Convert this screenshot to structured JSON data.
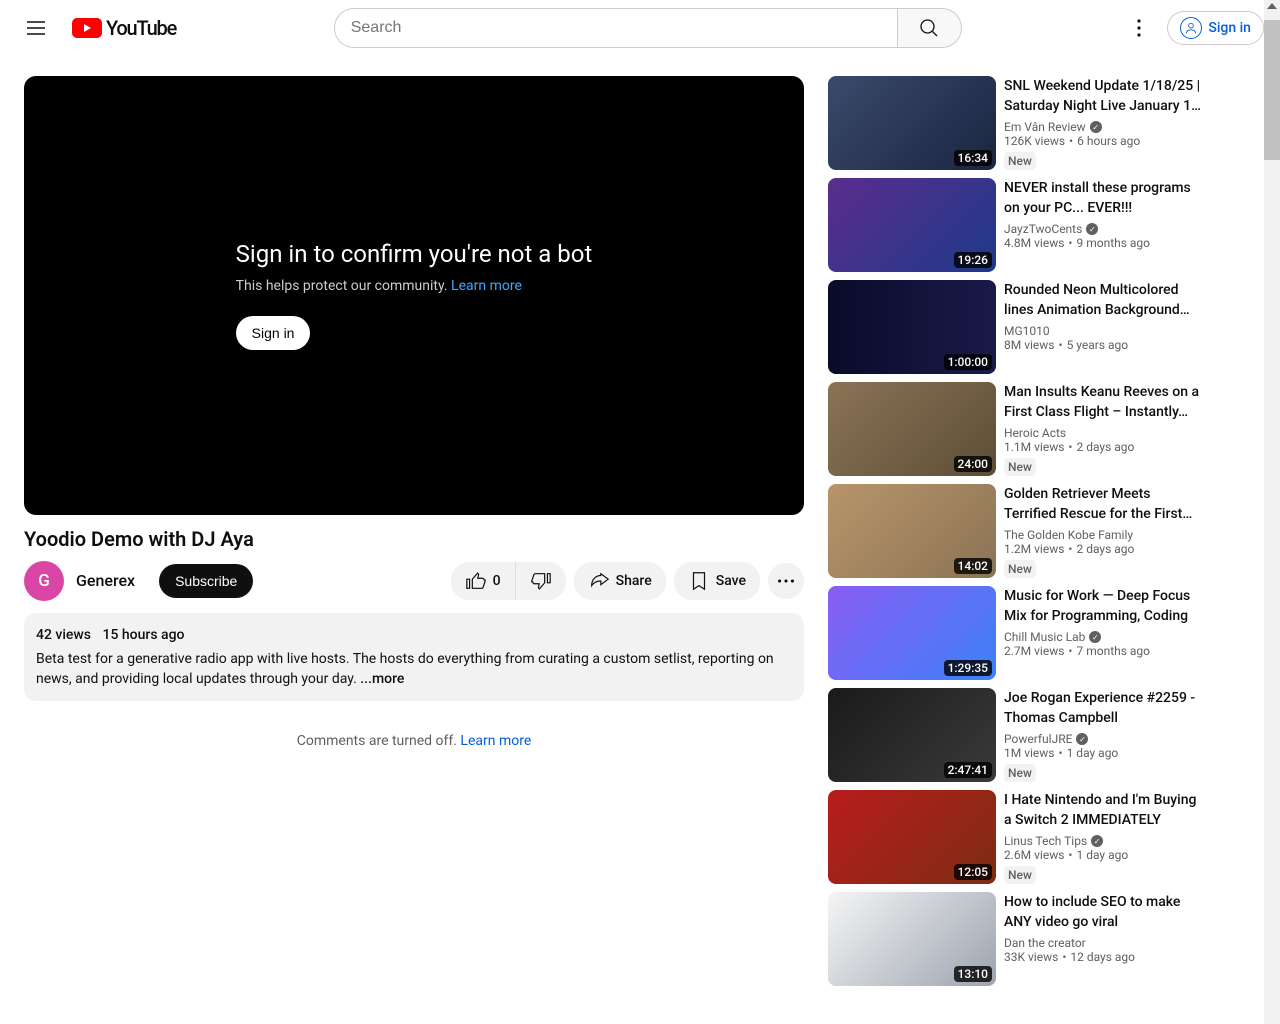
{
  "header": {
    "logo_text": "YouTube",
    "search_placeholder": "Search",
    "signin_label": "Sign in"
  },
  "player": {
    "prompt_title": "Sign in to confirm you're not a bot",
    "prompt_sub": "This helps protect our community. ",
    "learn_more": "Learn more",
    "signin_label": "Sign in"
  },
  "video": {
    "title": "Yoodio Demo with DJ Aya",
    "channel_initial": "G",
    "channel_name": "Generex",
    "subscribe_label": "Subscribe",
    "like_count": "0",
    "share_label": "Share",
    "save_label": "Save",
    "views": "42 views",
    "date": "15 hours ago",
    "description": "Beta test for a generative radio app with live hosts. The hosts do everything from curating a custom setlist, reporting on news, and providing local updates through your day. ",
    "more_label": "...more"
  },
  "comments": {
    "off_text": "Comments are turned off. ",
    "learn_more": "Learn more"
  },
  "badges": {
    "new": "New"
  },
  "suggestions": [
    {
      "title": "SNL Weekend Update 1/18/25 | Saturday Night Live January 1…",
      "channel": "Em Vân Review",
      "verified": true,
      "views": "126K views",
      "age": "6 hours ago",
      "duration": "16:34",
      "new": true,
      "tclass": "t0"
    },
    {
      "title": "NEVER install these programs on your PC... EVER!!!",
      "channel": "JayzTwoCents",
      "verified": true,
      "views": "4.8M views",
      "age": "9 months ago",
      "duration": "19:26",
      "new": false,
      "tclass": "t1"
    },
    {
      "title": "Rounded Neon Multicolored lines Animation Background…",
      "channel": "MG1010",
      "verified": false,
      "views": "8M views",
      "age": "5 years ago",
      "duration": "1:00:00",
      "new": false,
      "tclass": "t2"
    },
    {
      "title": "Man Insults Keanu Reeves on a First Class Flight – Instantly…",
      "channel": "Heroic Acts",
      "verified": false,
      "views": "1.1M views",
      "age": "2 days ago",
      "duration": "24:00",
      "new": true,
      "tclass": "t3"
    },
    {
      "title": "Golden Retriever Meets Terrified Rescue for the First…",
      "channel": "The Golden Kobe Family",
      "verified": false,
      "views": "1.2M views",
      "age": "2 days ago",
      "duration": "14:02",
      "new": true,
      "tclass": "t4"
    },
    {
      "title": "Music for Work — Deep Focus Mix for Programming, Coding",
      "channel": "Chill Music Lab",
      "verified": true,
      "views": "2.7M views",
      "age": "7 months ago",
      "duration": "1:29:35",
      "new": false,
      "tclass": "t5"
    },
    {
      "title": "Joe Rogan Experience #2259 - Thomas Campbell",
      "channel": "PowerfulJRE",
      "verified": true,
      "views": "1M views",
      "age": "1 day ago",
      "duration": "2:47:41",
      "new": true,
      "tclass": "t6"
    },
    {
      "title": "I Hate Nintendo and I'm Buying a Switch 2 IMMEDIATELY",
      "channel": "Linus Tech Tips",
      "verified": true,
      "views": "2.6M views",
      "age": "1 day ago",
      "duration": "12:05",
      "new": true,
      "tclass": "t7"
    },
    {
      "title": "How to include SEO to make ANY video go viral",
      "channel": "Dan the creator",
      "verified": false,
      "views": "33K views",
      "age": "12 days ago",
      "duration": "13:10",
      "new": false,
      "tclass": "t8"
    }
  ]
}
